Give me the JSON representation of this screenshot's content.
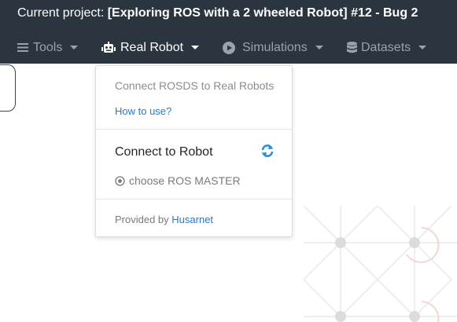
{
  "header": {
    "project_prefix": "Current project:",
    "project_name": "[Exploring ROS with a 2 wheeled Robot] #12 - Bug 2"
  },
  "menubar": {
    "items": [
      {
        "label": "Tools",
        "icon": "menu-lines-icon"
      },
      {
        "label": "Real Robot",
        "icon": "robot-icon"
      },
      {
        "label": "Simulations",
        "icon": "play-circle-icon"
      },
      {
        "label": "Datasets",
        "icon": "database-icon"
      }
    ]
  },
  "dropdown": {
    "header": "Connect ROSDS to Real Robots",
    "help_link": "How to use?",
    "connect_label": "Connect to Robot",
    "connect_icon": "refresh-icon",
    "choose_label": "choose ROS MASTER",
    "choose_icon": "radio-icon",
    "footer_prefix": "Provided by",
    "footer_brand": "Husarnet"
  },
  "colors": {
    "topbar": "#2b3540",
    "active_menu": "#ffffff",
    "inactive_menu": "#9aa3ad",
    "link": "#1f7ad6",
    "accent_icon": "#2b8de0"
  }
}
